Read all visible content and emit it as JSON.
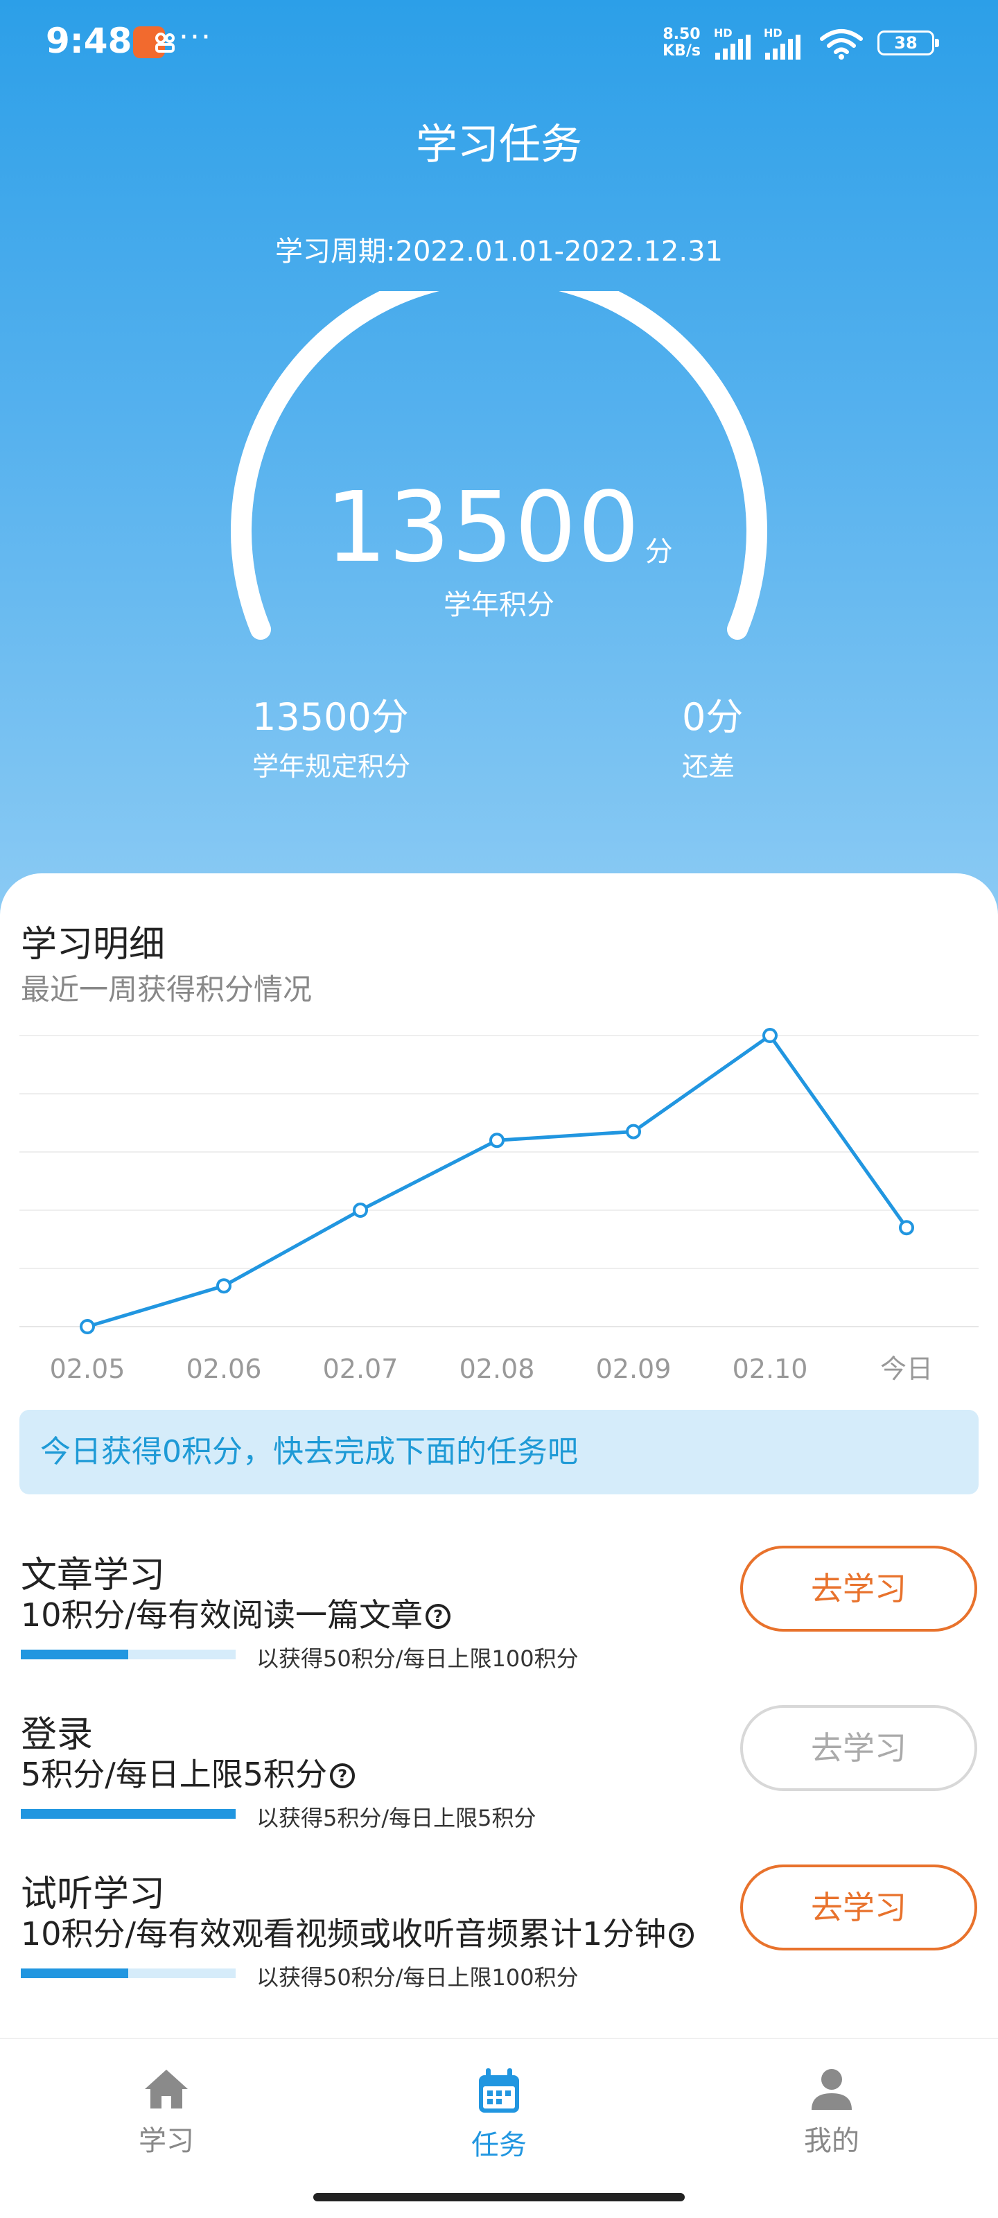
{
  "status_bar": {
    "time": "9:48",
    "app_badge": "",
    "more": "···",
    "net_speed_value": "8.50",
    "net_speed_unit": "KB/s",
    "hd_label": "HD",
    "battery": "38"
  },
  "header": {
    "title": "学习任务",
    "period": "学习周期:2022.01.01-2022.12.31"
  },
  "score": {
    "value": "13500",
    "unit": "分",
    "label": "学年积分",
    "gauge_fill_percent": 100
  },
  "stats": {
    "required_value": "13500分",
    "required_label": "学年规定积分",
    "remaining_value": "0分",
    "remaining_label": "还差"
  },
  "detail": {
    "title": "学习明细",
    "subtitle": "最近一周获得积分情况"
  },
  "chart_data": {
    "type": "line",
    "categories": [
      "02.05",
      "02.06",
      "02.07",
      "02.08",
      "02.09",
      "02.10",
      "今日"
    ],
    "series": [
      {
        "values": [
          0,
          14,
          40,
          64,
          67,
          100,
          34
        ]
      }
    ],
    "ylim": [
      0,
      100
    ],
    "grid": true,
    "color": "#2196e0"
  },
  "notice": "今日获得0积分，快去完成下面的任务吧",
  "tasks": [
    {
      "name": "文章学习",
      "desc": "10积分/每有效阅读一篇文章",
      "progress_text": "以获得50积分/每日上限100积分",
      "progress_fraction": 0.5,
      "button": "去学习",
      "enabled": true
    },
    {
      "name": "登录",
      "desc": "5积分/每日上限5积分",
      "progress_text": "以获得5积分/每日上限5积分",
      "progress_fraction": 1.0,
      "button": "去学习",
      "enabled": false
    },
    {
      "name": "试听学习",
      "desc": "10积分/每有效观看视频或收听音频累计1分钟",
      "progress_text": "以获得50积分/每日上限100积分",
      "progress_fraction": 0.5,
      "button": "去学习",
      "enabled": true
    }
  ],
  "tabbar": {
    "items": [
      {
        "label": "学习",
        "icon": "home-icon"
      },
      {
        "label": "任务",
        "icon": "calendar-icon"
      },
      {
        "label": "我的",
        "icon": "user-icon"
      }
    ],
    "active": 1
  },
  "colors": {
    "accent": "#2196e0",
    "button": "#e8722c",
    "hero_top": "#2c9fe8",
    "hero_bottom": "#8ccbf4"
  }
}
